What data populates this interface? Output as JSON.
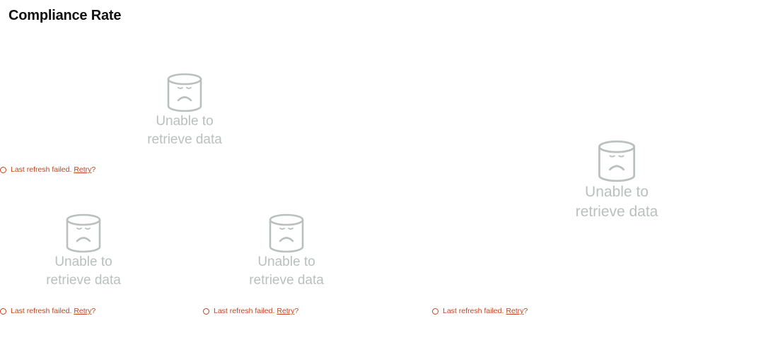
{
  "page": {
    "title": "Compliance Rate"
  },
  "colors": {
    "empty_state": "#b9c0be",
    "error_text": "#c0441e",
    "title": "#111111"
  },
  "panels": [
    {
      "empty_state": {
        "icon": "sad-database-icon",
        "message_line1": "Unable to",
        "message_line2": "retrieve data"
      },
      "refresh": {
        "prefix": "Last refresh failed.",
        "retry_label": "Retry",
        "suffix": "?"
      }
    },
    {
      "empty_state": {
        "icon": "sad-database-icon",
        "message_line1": "Unable to",
        "message_line2": "retrieve data"
      },
      "refresh": {
        "prefix": "Last refresh failed.",
        "retry_label": "Retry",
        "suffix": "?"
      }
    },
    {
      "empty_state": {
        "icon": "sad-database-icon",
        "message_line1": "Unable to",
        "message_line2": "retrieve data"
      },
      "refresh": {
        "prefix": "Last refresh failed.",
        "retry_label": "Retry",
        "suffix": "?"
      }
    },
    {
      "empty_state": {
        "icon": "sad-database-icon",
        "message_line1": "Unable to",
        "message_line2": "retrieve data"
      },
      "refresh": {
        "prefix": "Last refresh failed.",
        "retry_label": "Retry",
        "suffix": "?"
      }
    }
  ]
}
